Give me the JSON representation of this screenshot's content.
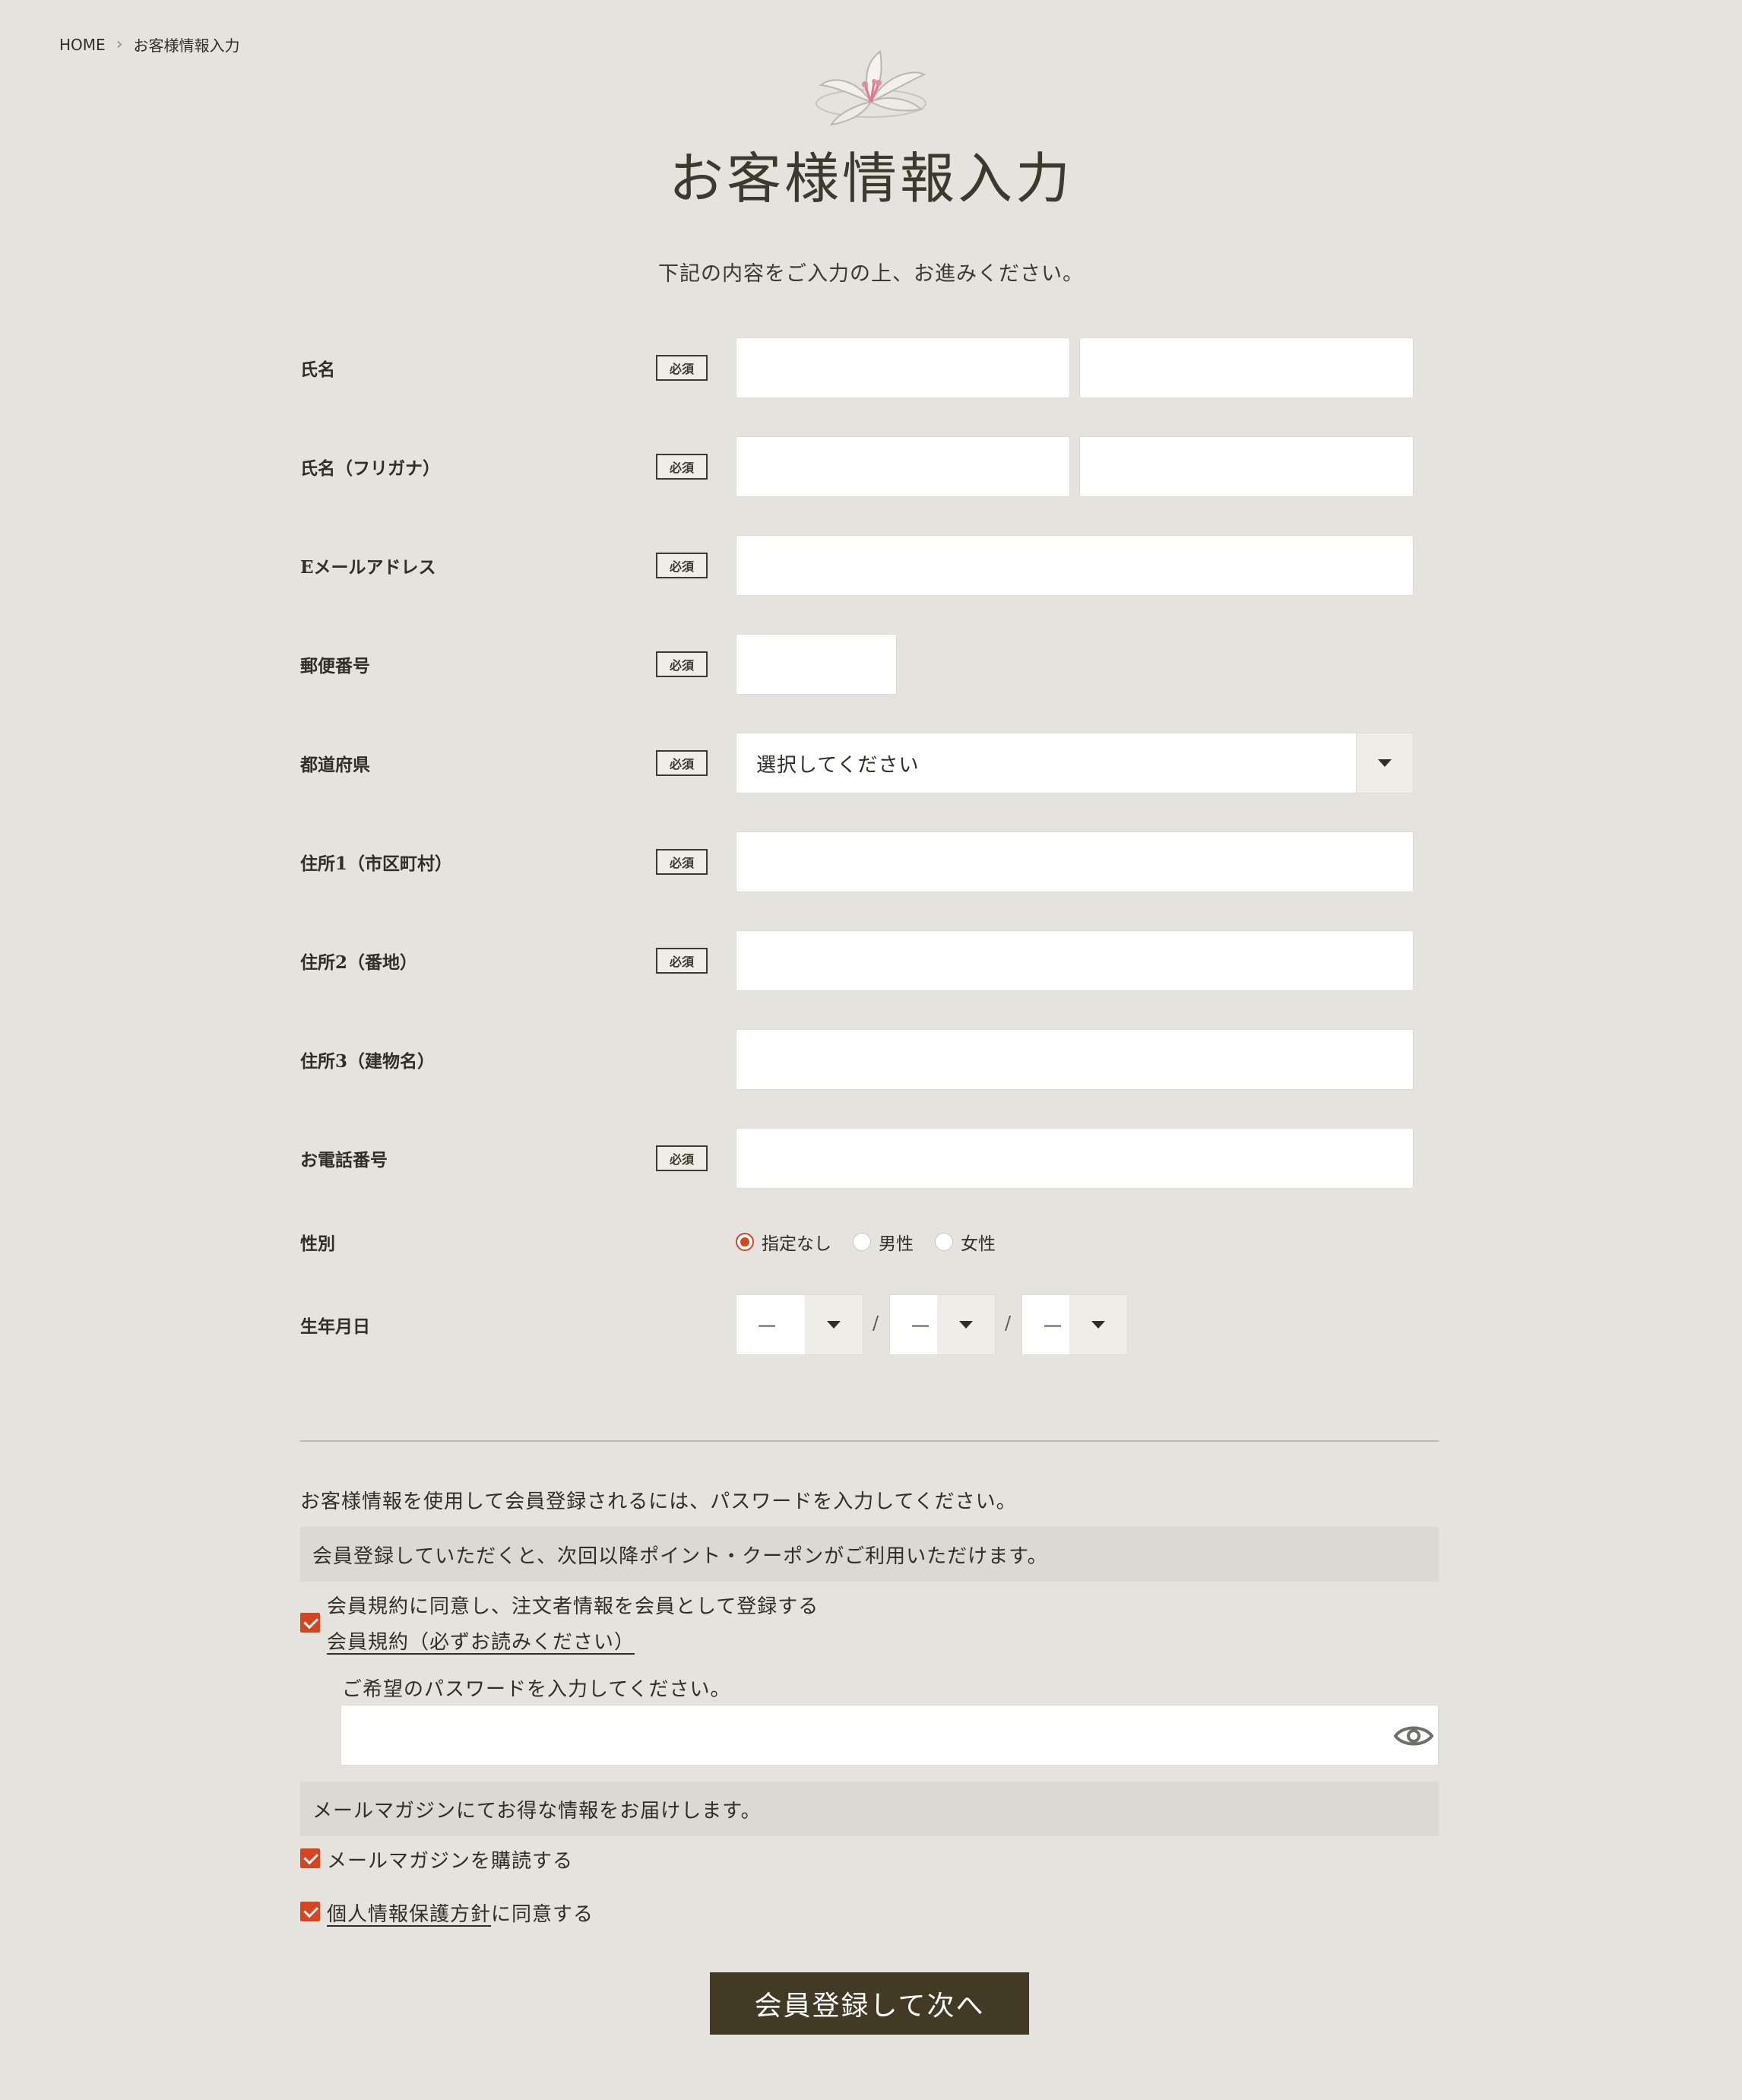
{
  "breadcrumb": {
    "home": "HOME",
    "current": "お客様情報入力"
  },
  "page": {
    "title": "お客様情報入力",
    "lead": "下記の内容をご入力の上、お進みください。"
  },
  "required_badge": "必須",
  "fields": {
    "name": {
      "label": "氏名"
    },
    "kana": {
      "label": "氏名（フリガナ）"
    },
    "email": {
      "label": "Eメールアドレス"
    },
    "zip": {
      "label": "郵便番号"
    },
    "pref": {
      "label": "都道府県",
      "selected": "選択してください"
    },
    "addr1": {
      "label": "住所1（市区町村）"
    },
    "addr2": {
      "label": "住所2（番地）"
    },
    "addr3": {
      "label": "住所3（建物名）"
    },
    "tel": {
      "label": "お電話番号"
    },
    "gender": {
      "label": "性別",
      "options": [
        "指定なし",
        "男性",
        "女性"
      ],
      "selected": "指定なし"
    },
    "birthday": {
      "label": "生年月日",
      "year": "—",
      "month": "—",
      "day": "—",
      "separator": "/"
    }
  },
  "member": {
    "note": "お客様情報を使用して会員登録されるには、パスワードを入力してください。",
    "band": "会員登録していただくと、次回以降ポイント・クーポンがご利用いただけます。",
    "agree_label": "会員規約に同意し、注文者情報を会員として登録する",
    "terms_link": "会員規約（必ずお読みください）",
    "password_prompt": "ご希望のパスワードを入力してください。",
    "agree_checked": true
  },
  "newsletter": {
    "band": "メールマガジンにてお得な情報をお届けします。",
    "label": "メールマガジンを購読する",
    "checked": true
  },
  "privacy": {
    "link": "個人情報保護方針",
    "suffix": "に同意する",
    "checked": true
  },
  "submit_label": "会員登録して次へ",
  "colors": {
    "background": "#e4e3dd",
    "accent": "#d9441e",
    "button": "#423a25",
    "text": "#3b3a2e"
  }
}
